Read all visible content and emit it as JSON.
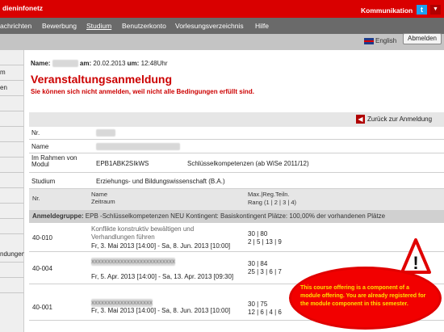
{
  "header": {
    "brand": "dieninfonetz",
    "kommunikation": "Kommunikation",
    "twitter_glyph": "t",
    "dropdown_glyph": "▼"
  },
  "nav": {
    "items": [
      "achrichten",
      "Bewerbung",
      "Studium",
      "Benutzerkonto",
      "Vorlesungsverzeichnis",
      "Hilfe"
    ],
    "active": "Studium"
  },
  "lang": {
    "label": "English",
    "logout": "Abmelden"
  },
  "sidebar": {
    "items": [
      "",
      "m",
      "en",
      "",
      "",
      "",
      "",
      "",
      "",
      "",
      "",
      "",
      "ndungen",
      "",
      "",
      ""
    ]
  },
  "meta": {
    "name_label": "Name:",
    "name_value": "xxxxxxxx",
    "am_label": "am:",
    "date": "20.02.2013",
    "um_label": "um:",
    "time": "12:48Uhr"
  },
  "page": {
    "title": "Veranstaltungsanmeldung",
    "warning": "Sie können sich nicht anmelden, weil nicht alle Bedingungen erfüllt sind.",
    "back_link": "Zurück zur Anmeldung",
    "back_glyph": "◀"
  },
  "details": {
    "nr_label": "Nr.",
    "nr_value": "xxxxxx",
    "name_label": "Name",
    "name_value": "xxxxxxxxxxxxxxxxxxxxxxxxxx",
    "rahmen_label": "Im Rahmen von Modul",
    "rahmen_code": "EPB1ABK2SIkWS",
    "rahmen_value": "Schlüsselkompetenzen (ab WiSe 2011/12)",
    "studium_label": "Studium",
    "studium_value": "Erziehungs- und Bildungswissenschaft (B.A.)"
  },
  "table": {
    "h_nr": "Nr.",
    "h_name": "Name",
    "h_zeitraum": "Zeitraum",
    "h_max": "Max.|Reg.Teiln.",
    "h_rang": "Rang (1 | 2 | 3 | 4)",
    "group_label": "Anmeldegruppe:",
    "group_value": "EPB -Schlüsselkompetenzen NEU Kontingent: Basiskontingent Plätze: 100,00% der vorhandenen Plätze",
    "courses": [
      {
        "nr": "40-010",
        "name1": "Konflikte konstruktiv bewältigen und",
        "name2": "Verhandlungen führen",
        "time": "Fr, 3. Mai 2013 [14:00] - Sa, 8. Jun. 2013 [10:00]",
        "max": "30 | 80",
        "rang": "2 | 5 | 13 | 9"
      },
      {
        "nr": "40-004",
        "name1": "xxxxxxxxxxxxxxxxxxxxxxxxxx",
        "name2": "",
        "time": "Fr, 5. Apr. 2013 [14:00] - Sa, 13. Apr. 2013 [09:30]",
        "max": "30 | 84",
        "rang": "25 | 3 | 6 | 7"
      },
      {
        "nr": "40-001",
        "name1": "xxxxxxxxxxxxxxxxxxx",
        "name2": "",
        "time": "Fr, 3. Mai 2013 [14:00] - Sa, 8. Jun. 2013 [10:00]",
        "max": "30 | 75",
        "rang": "12 | 6 | 4 | 6"
      }
    ]
  },
  "callout": {
    "text": "This course offering is a component of a module offering. You are already registered for the module component in this semester.",
    "warning_glyph": "!"
  },
  "colors": {
    "accent": "#d90000",
    "nav": "#6a6a6a",
    "callout": "#f20000",
    "callout_text": "#ffe000"
  }
}
